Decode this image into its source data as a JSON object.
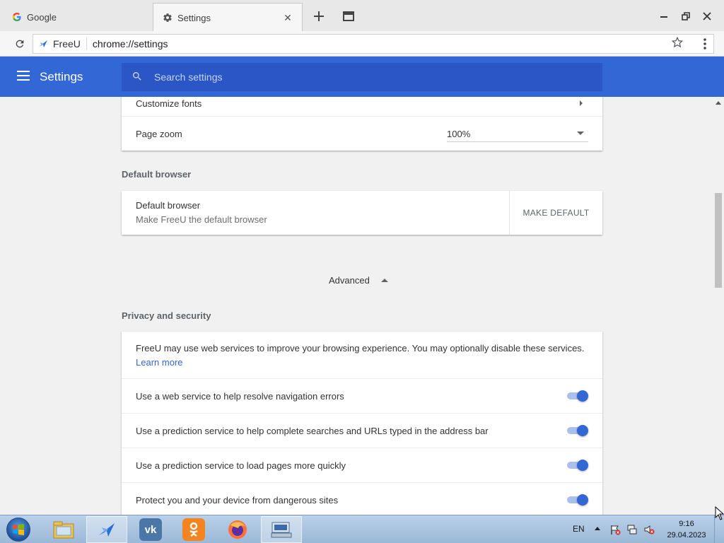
{
  "browser": {
    "tabs": [
      {
        "label": "Google",
        "favicon": "google-icon",
        "active": false
      },
      {
        "label": "Settings",
        "favicon": "gear-icon",
        "active": true
      }
    ],
    "brand_label": "FreeU",
    "url": "chrome://settings"
  },
  "settings_header": {
    "title": "Settings",
    "search_placeholder": "Search settings",
    "accent_color": "#3367d6"
  },
  "appearance": {
    "customize_fonts_label": "Customize fonts",
    "page_zoom_label": "Page zoom",
    "page_zoom_value": "100%"
  },
  "default_browser": {
    "section_title": "Default browser",
    "row_title": "Default browser",
    "row_subtitle": "Make FreeU the default browser",
    "button_label": "MAKE DEFAULT"
  },
  "advanced": {
    "label": "Advanced"
  },
  "privacy": {
    "section_title": "Privacy and security",
    "intro_text": "FreeU may use web services to improve your browsing experience. You may optionally disable these services.",
    "learn_more": "Learn more",
    "toggles": [
      {
        "label": "Use a web service to help resolve navigation errors",
        "on": true
      },
      {
        "label": "Use a prediction service to help complete searches and URLs typed in the address bar",
        "on": true
      },
      {
        "label": "Use a prediction service to load pages more quickly",
        "on": true
      },
      {
        "label": "Protect you and your device from dangerous sites",
        "on": true
      }
    ]
  },
  "taskbar": {
    "language": "EN",
    "time": "9:16",
    "date": "29.04.2023"
  }
}
